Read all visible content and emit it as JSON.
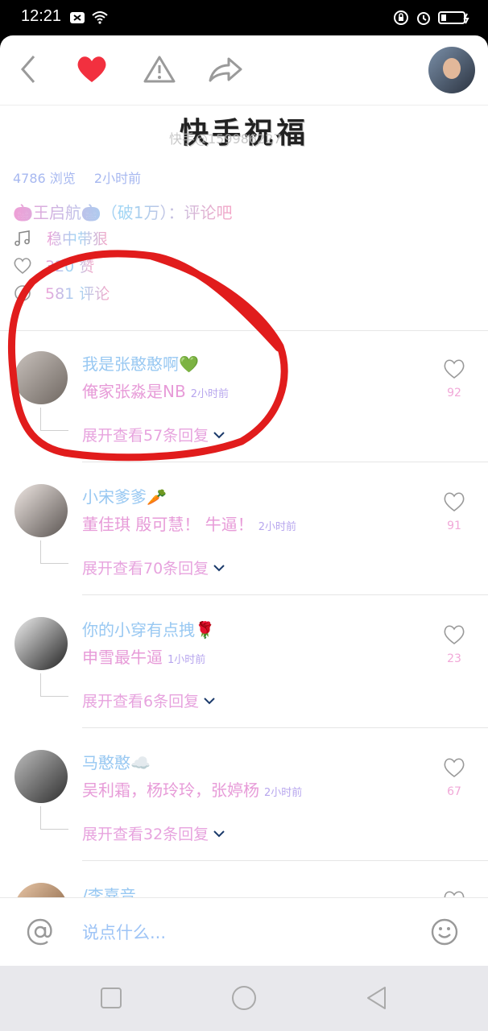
{
  "status": {
    "time": "12:21"
  },
  "caption": {
    "title": "快手祝福",
    "watermark": "快手@159986227"
  },
  "meta": {
    "views": "4786 浏览",
    "time": "2小时前"
  },
  "info": {
    "author_line": "🎃王启航🎃（破1万）：评论吧",
    "music": "稳中带狠",
    "likes": "320 赞",
    "comments": "581 评论"
  },
  "comments": [
    {
      "name": "我是张憨憨啊💚",
      "text": "俺家张淼是NB",
      "time": "2小时前",
      "expand": "展开查看57条回复",
      "likes": "92"
    },
    {
      "name": "小宋爹爹🥕",
      "text": "董佳琪 殷可慧！ 牛逼！",
      "time": "2小时前",
      "expand": "展开查看70条回复",
      "likes": "91"
    },
    {
      "name": "你的小穿有点拽🌹",
      "text": "申雪最牛逼",
      "time": "1小时前",
      "expand": "展开查看6条回复",
      "likes": "23"
    },
    {
      "name": "马憨憨☁️",
      "text": "吴利霜，杨玲玲，张婷杨",
      "time": "2小时前",
      "expand": "展开查看32条回复",
      "likes": "67"
    },
    {
      "name": "/李嘉音，",
      "text": "",
      "time": "",
      "expand": "",
      "likes": ""
    }
  ],
  "input": {
    "placeholder": "说点什么..."
  },
  "colors": {
    "heart_red": "#f2303f",
    "annotation_red": "#e11c1c"
  }
}
